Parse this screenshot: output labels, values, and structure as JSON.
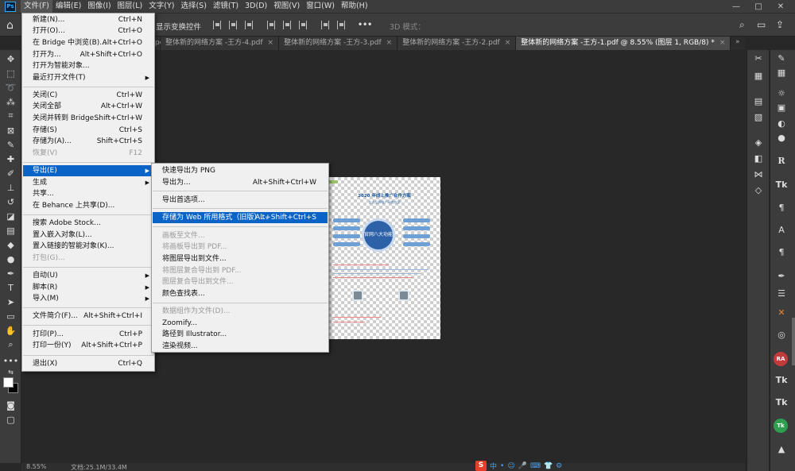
{
  "menubar": {
    "logo": "Ps",
    "items": [
      "文件(F)",
      "编辑(E)",
      "图像(I)",
      "图层(L)",
      "文字(Y)",
      "选择(S)",
      "滤镜(T)",
      "3D(D)",
      "视图(V)",
      "窗口(W)",
      "帮助(H)"
    ],
    "window_controls": [
      "—",
      "□",
      "✕"
    ]
  },
  "options": {
    "transform_controls": "显示变换控件",
    "mode_3d": "3D 模式：",
    "more": "•••"
  },
  "tabs": [
    {
      "label": "pdf",
      "close": "×"
    },
    {
      "label": "整体新的网络方案 -王方-4.pdf",
      "close": "×"
    },
    {
      "label": "整体新的网络方案 -王方-3.pdf",
      "close": "×"
    },
    {
      "label": "整体新的网络方案 -王方-2.pdf",
      "close": "×"
    },
    {
      "label": "整体新的网络方案 -王方-1.pdf @ 8.55% (图层 1, RGB/8) *",
      "close": "×"
    }
  ],
  "tabs_overflow": "»",
  "file_menu": [
    {
      "label": "新建(N)...",
      "shortcut": "Ctrl+N"
    },
    {
      "label": "打开(O)...",
      "shortcut": "Ctrl+O"
    },
    {
      "label": "在 Bridge 中浏览(B)...",
      "shortcut": "Alt+Ctrl+O"
    },
    {
      "label": "打开为...",
      "shortcut": "Alt+Shift+Ctrl+O"
    },
    {
      "label": "打开为智能对象..."
    },
    {
      "label": "最近打开文件(T)",
      "arrow": "▶"
    },
    {
      "label": "关闭(C)",
      "shortcut": "Ctrl+W"
    },
    {
      "label": "关闭全部",
      "shortcut": "Alt+Ctrl+W"
    },
    {
      "label": "关闭并转到 Bridge...",
      "shortcut": "Shift+Ctrl+W"
    },
    {
      "label": "存储(S)",
      "shortcut": "Ctrl+S"
    },
    {
      "label": "存储为(A)...",
      "shortcut": "Shift+Ctrl+S"
    },
    {
      "label": "恢复(V)",
      "shortcut": "F12",
      "disabled": true
    },
    {
      "label": "导出(E)",
      "arrow": "▶",
      "highlighted": true
    },
    {
      "label": "生成",
      "arrow": "▶"
    },
    {
      "label": "共享..."
    },
    {
      "label": "在 Behance 上共享(D)..."
    },
    {
      "label": "搜索 Adobe Stock..."
    },
    {
      "label": "置入嵌入对象(L)..."
    },
    {
      "label": "置入链接的智能对象(K)..."
    },
    {
      "label": "打包(G)...",
      "disabled": true
    },
    {
      "label": "自动(U)",
      "arrow": "▶"
    },
    {
      "label": "脚本(R)",
      "arrow": "▶"
    },
    {
      "label": "导入(M)",
      "arrow": "▶"
    },
    {
      "label": "文件简介(F)...",
      "shortcut": "Alt+Shift+Ctrl+I"
    },
    {
      "label": "打印(P)...",
      "shortcut": "Ctrl+P"
    },
    {
      "label": "打印一份(Y)",
      "shortcut": "Alt+Shift+Ctrl+P"
    },
    {
      "label": "退出(X)",
      "shortcut": "Ctrl+Q"
    }
  ],
  "export_menu": [
    {
      "label": "快速导出为 PNG"
    },
    {
      "label": "导出为...",
      "shortcut": "Alt+Shift+Ctrl+W"
    },
    {
      "label": "导出首选项..."
    },
    {
      "label": "存储为 Web 所用格式（旧版）...",
      "shortcut": "Alt+Shift+Ctrl+S",
      "highlighted": true
    },
    {
      "label": "画板至文件...",
      "disabled": true
    },
    {
      "label": "将画板导出到 PDF...",
      "disabled": true
    },
    {
      "label": "将图层导出到文件..."
    },
    {
      "label": "将图层复合导出到 PDF...",
      "disabled": true
    },
    {
      "label": "图层复合导出到文件...",
      "disabled": true
    },
    {
      "label": "颜色查找表..."
    },
    {
      "label": "数据组作为文件(D)...",
      "disabled": true
    },
    {
      "label": "Zoomify..."
    },
    {
      "label": "路径到 Illustrator..."
    },
    {
      "label": "渲染视频..."
    }
  ],
  "document": {
    "title": "2020 年线上推广合作方案",
    "subtitle": "企业品牌推广网络方案",
    "circle_text": "官网八大功能"
  },
  "status": {
    "zoom": "8.55%",
    "doc_info": "文档:25.1M/33.4M"
  },
  "ime": {
    "logo": "S",
    "items": [
      "中",
      "•",
      "☺",
      "🎤",
      "⌨",
      "👕",
      "⚙"
    ]
  }
}
